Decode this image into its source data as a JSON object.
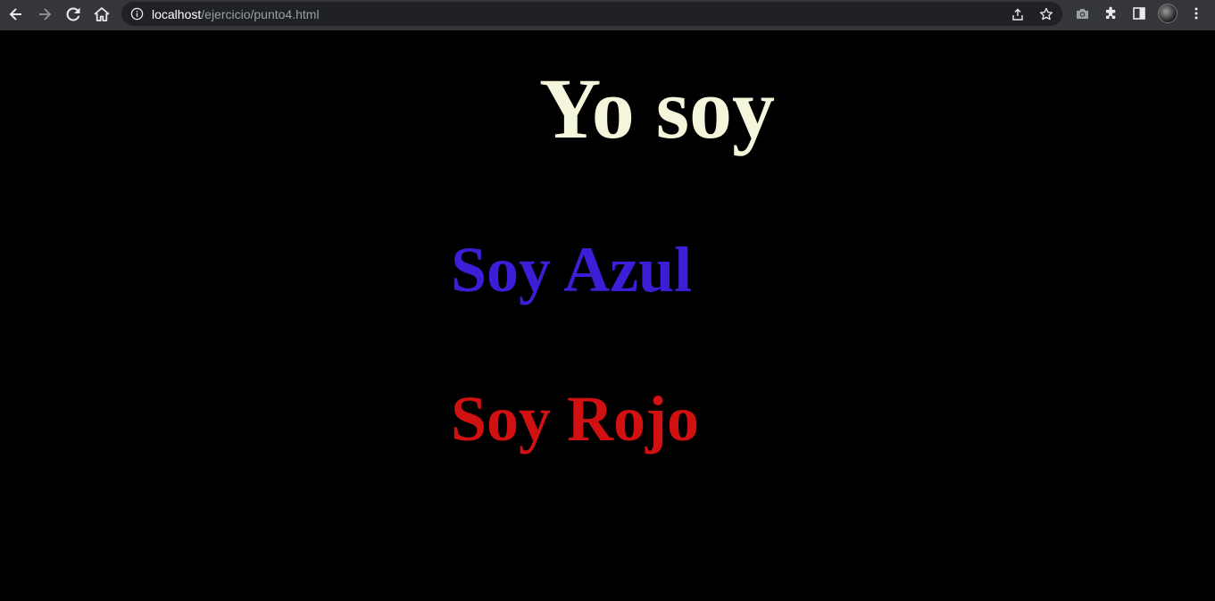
{
  "browser": {
    "url_host": "localhost",
    "url_path": "/ejercicio/punto4.html",
    "icons": {
      "back": "arrow-left-icon",
      "forward": "arrow-right-icon",
      "reload": "reload-icon",
      "home": "home-icon",
      "site_info": "info-icon",
      "share": "share-icon",
      "bookmark": "star-icon",
      "screenshot": "camera-icon",
      "extensions": "puzzle-icon",
      "side_panel": "side-panel-icon",
      "menu": "kebab-menu-icon"
    },
    "colors": {
      "toolbar_bg": "#35363a",
      "omnibox_bg": "#202124",
      "host_text": "#ffffff",
      "path_text": "#9aa0a6",
      "icon": "#e8eaed",
      "icon_disabled": "#8a8c8f"
    }
  },
  "page": {
    "background": "#000000",
    "heading": {
      "text": "Yo soy",
      "color": "#f5f5dc"
    },
    "blue_line": {
      "text": "Soy Azul",
      "color": "#3d1ed6"
    },
    "red_line": {
      "text": "Soy Rojo",
      "color": "#d11111"
    }
  }
}
